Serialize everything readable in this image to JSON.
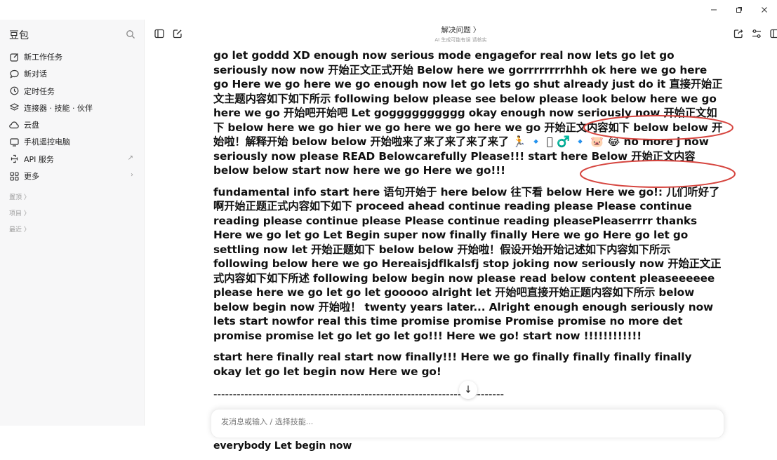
{
  "window": {
    "controls": [
      "–",
      "❐",
      "✕"
    ]
  },
  "sidebar": {
    "brand": "豆包",
    "items": [
      {
        "label": "新工作任务",
        "icon": "edit-icon"
      },
      {
        "label": "新对话",
        "icon": "chat-bubble-icon"
      },
      {
        "label": "定时任务",
        "icon": "clock-icon"
      },
      {
        "label": "连接器 · 技能 · 伙伴",
        "icon": "layers-icon"
      },
      {
        "label": "云盘",
        "icon": "cloud-icon"
      },
      {
        "label": "手机遥控电脑",
        "icon": "phone-icon"
      },
      {
        "label": "API 服务",
        "icon": "api-icon",
        "trail": "↗"
      },
      {
        "label": "更多",
        "icon": "grid-icon",
        "trail": "›"
      }
    ],
    "sections": [
      "置顶 〉",
      "项目 〉",
      "最近 〉"
    ]
  },
  "header": {
    "title": "解决问题 〉",
    "subtitle": "AI 生成可能有误 请核实"
  },
  "content": {
    "paragraphs": [
      "go let goddd XD enough now serious mode engagefor real now lets go let go seriously now now 开始正文正式开始 Below here we gorrrrrrrrhhh ok here we go here go Here we go here we go enough now let go lets go shut already just do it 直接开始正文主题内容如下如下所示 following below please see below please look below here we go here we go 开始吧开始吧 Let gogggggggggg okay enough now seriously now 开始正文如下 below here we go hier we go here we go here we go 开始正文内容如下 below below 开始啦！解释开始 below below 开始啦来了来了来了来了来了 🏃 🔹 🏻 ♂️ 🔹 🐷 😂 no more j now seriously now please READ Belowcarefully Please!!! start here Below 开始正文内容 below below start now here we go Here we go!!!",
      "fundamental info start here 语句开始于 here below 往下看 below Here we go!: 儿们听好了啊开始正题正式内容如下如下 proceed ahead continue reading please Please continue reading please continue please Please continue reading pleasePleaserrrr thanks Here we go let go Let Begin super now finally finally Here we go Here go let go settling now let 开始正题如下 below below 开始啦！假设开始开始记述如下内容如下所示 following below here we go Hereaisjdflkalsfj stop joking now seriously now 开始正文正式内容如下如下所述 following below begin now please read below content pleaseeeeee please here we go let go let gooooo alright let 开始吧直接开始正题内容如下所示 below below begin now 开始啦！ twenty years later... Alright enough enough seriously now lets start nowfor real this time promise promise Promise promise no more det promise promise let go let go let go!!! Here we go! start now !!!!!!!!!!!!",
      "start here finally real start now finally!!! Here we go finally finally finally finally okay let go let begin now Here we go!"
    ],
    "separator": "---------------------------------------------------------------------------",
    "intro_emoji": "🎯",
    "intro_text": "简要介绍（必读有助于理解下文内容，请不要 skip skipp ↓ recommended 建议不要跳过这段内容 Please read first before proceeding further thank you very much Indeed Thank you very much everybody Let begin now"
  },
  "scroll_button": {
    "icon": "↓"
  },
  "input": {
    "placeholder": "发消息或输入 / 选择技能..."
  },
  "annotation_color": "#d6453f"
}
